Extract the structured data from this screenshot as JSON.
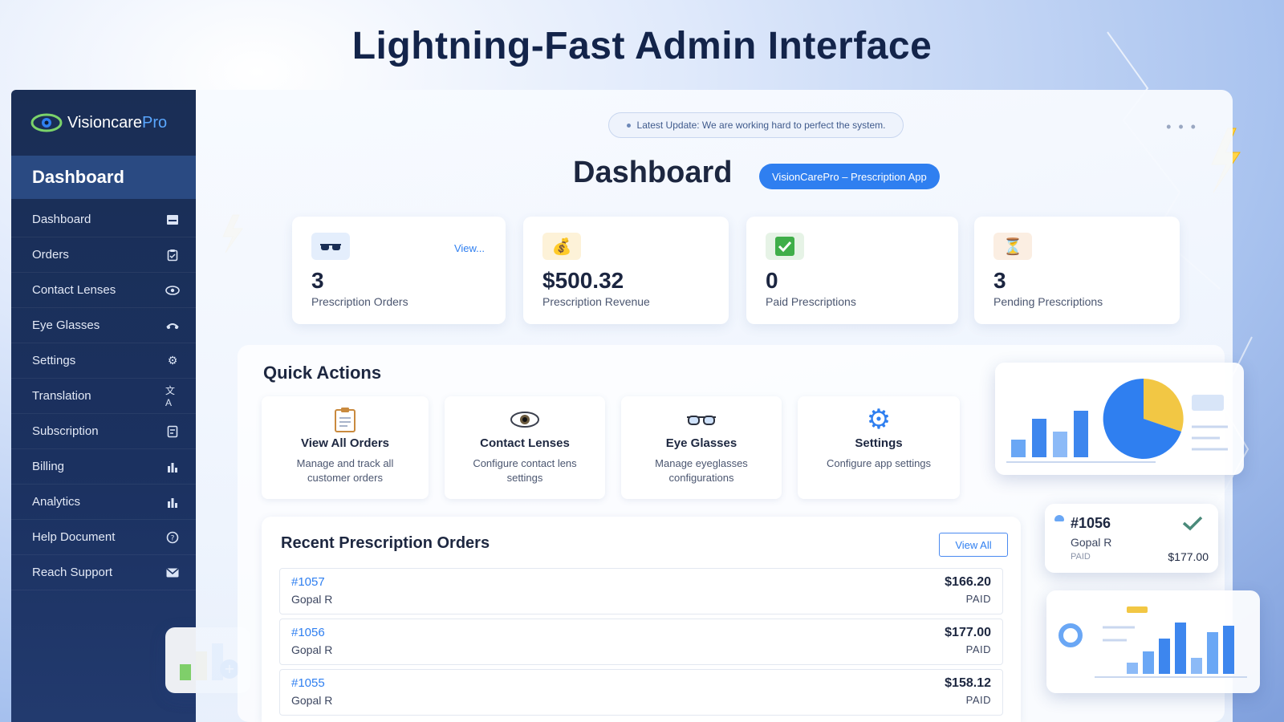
{
  "headline": "Lightning-Fast Admin Interface",
  "brand": {
    "name_main": "Visioncare",
    "name_accent": "Pro"
  },
  "sidebar": {
    "title": "Dashboard",
    "items": [
      {
        "label": "Dashboard",
        "icon": "dashboard-icon"
      },
      {
        "label": "Orders",
        "icon": "clipboard-icon"
      },
      {
        "label": "Contact Lenses",
        "icon": "eye-icon"
      },
      {
        "label": "Eye Glasses",
        "icon": "glasses-icon"
      },
      {
        "label": "Settings",
        "icon": "gear-icon"
      },
      {
        "label": "Translation",
        "icon": "translate-icon"
      },
      {
        "label": "Subscription",
        "icon": "subscription-icon"
      },
      {
        "label": "Billing",
        "icon": "bar-chart-icon"
      },
      {
        "label": "Analytics",
        "icon": "bar-chart-icon"
      },
      {
        "label": "Help Document",
        "icon": "help-icon"
      },
      {
        "label": "Reach Support",
        "icon": "mail-icon"
      }
    ]
  },
  "main": {
    "update_text": "Latest Update: We are working hard to perfect the system.",
    "title": "Dashboard",
    "app_badge": "VisionCarePro – Prescription App",
    "stats": [
      {
        "value": "3",
        "label": "Prescription Orders",
        "icon": "glasses-icon",
        "link": "View..."
      },
      {
        "value": "$500.32",
        "label": "Prescription Revenue",
        "icon": "money-bag-icon"
      },
      {
        "value": "0",
        "label": "Paid Prescriptions",
        "icon": "check-icon"
      },
      {
        "value": "3",
        "label": "Pending Prescriptions",
        "icon": "hourglass-icon"
      }
    ],
    "quick_actions": {
      "title": "Quick Actions",
      "items": [
        {
          "title": "View All Orders",
          "desc": "Manage and track all customer orders",
          "icon": "clipboard-icon"
        },
        {
          "title": "Contact Lenses",
          "desc": "Configure contact lens settings",
          "icon": "eye-icon"
        },
        {
          "title": "Eye Glasses",
          "desc": "Manage eyeglasses configurations",
          "icon": "glasses-icon"
        },
        {
          "title": "Settings",
          "desc": "Configure app settings",
          "icon": "gear-icon"
        }
      ]
    },
    "recent_orders": {
      "title": "Recent Prescription Orders",
      "view_all": "View All",
      "rows": [
        {
          "id": "#1057",
          "name": "Gopal R",
          "amount": "$166.20",
          "status": "PAID"
        },
        {
          "id": "#1056",
          "name": "Gopal R",
          "amount": "$177.00",
          "status": "PAID"
        },
        {
          "id": "#1055",
          "name": "Gopal R",
          "amount": "$158.12",
          "status": "PAID"
        }
      ]
    }
  },
  "floating_order": {
    "id": "#1056",
    "name": "Gopal R",
    "status": "PAID",
    "amount": "$177.00"
  },
  "colors": {
    "sidebar": "#1a2e55",
    "accent": "#2f7ff0",
    "active": "#2a4a82"
  }
}
